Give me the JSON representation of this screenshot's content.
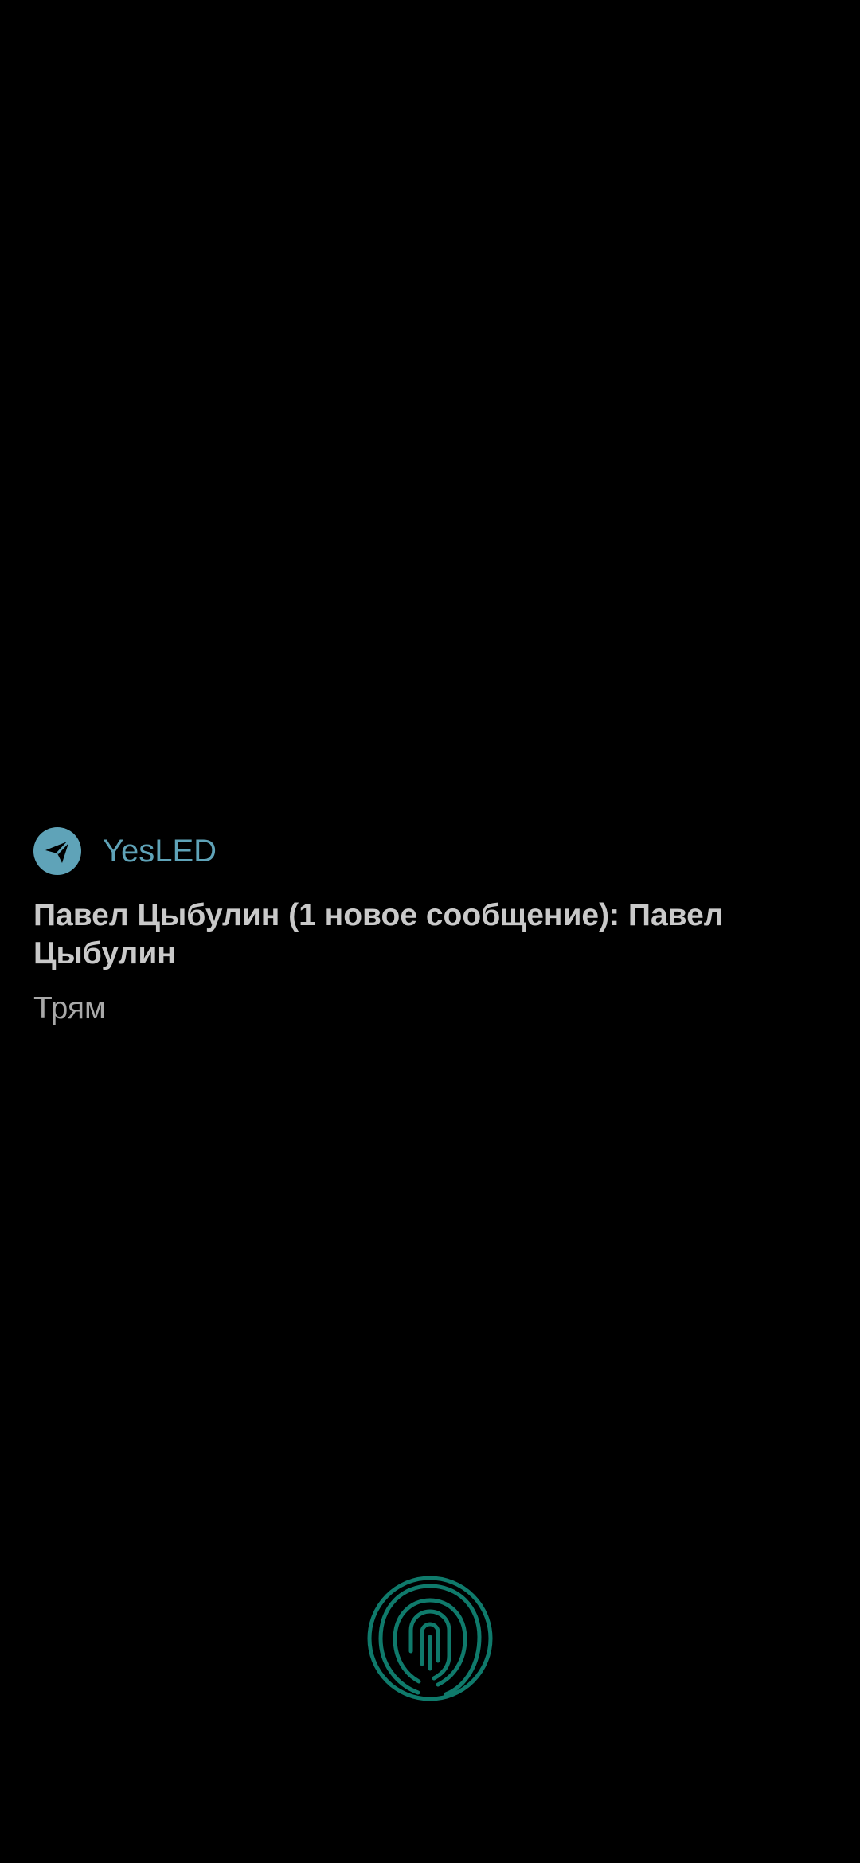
{
  "notification": {
    "app_icon": "telegram-send-icon",
    "app_name": "YesLED",
    "title": "Павел Цыбулин (1 новое сообщение): Павел Цыбулин",
    "text": "Трям"
  },
  "fingerprint": {
    "icon": "fingerprint-icon"
  },
  "colors": {
    "background": "#000000",
    "accent": "#5fa3b8",
    "title": "#c9c9c9",
    "text": "#a9a9a9",
    "fingerprint": "#0f7a6b"
  }
}
